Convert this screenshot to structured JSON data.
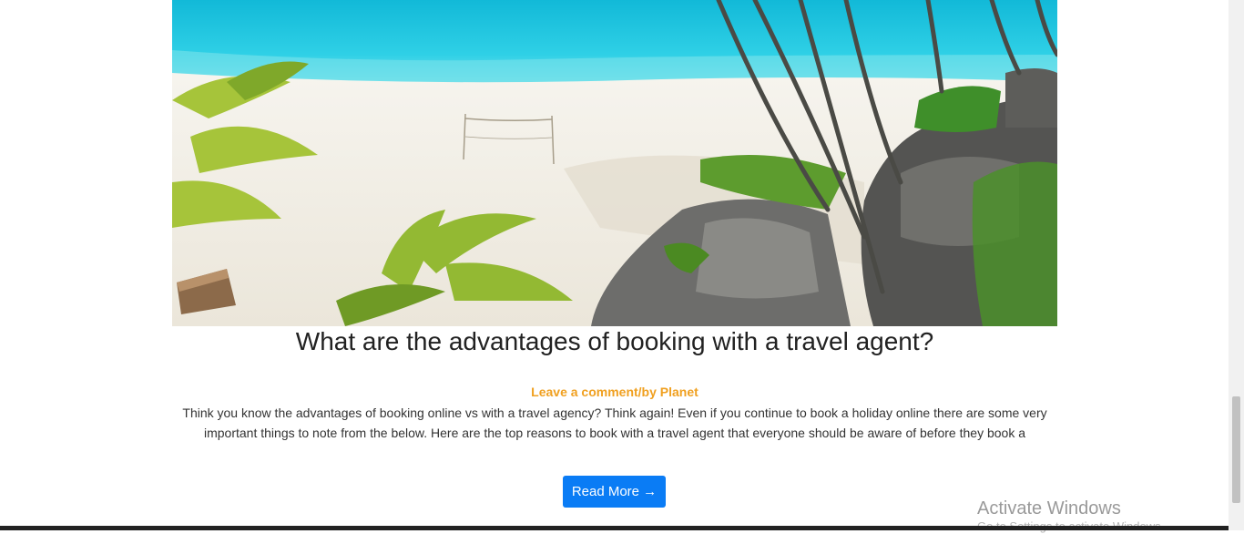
{
  "post": {
    "title": "What are the advantages of booking with a travel agent?",
    "meta": "Leave a comment/by Planet",
    "excerpt": "Think you know the advantages of booking online vs with a travel agency? Think again! Even if you continue to book a holiday online there are some very important things to note from the below. Here are the top reasons to book with a travel agent that everyone should be aware of before they book a",
    "read_more_label": "Read More →"
  },
  "watermark": {
    "title": "Activate Windows",
    "subtitle": "Go to Settings to activate Windows."
  },
  "colors": {
    "meta_accent": "#f0a020",
    "button_blue": "#0a7cf5"
  }
}
